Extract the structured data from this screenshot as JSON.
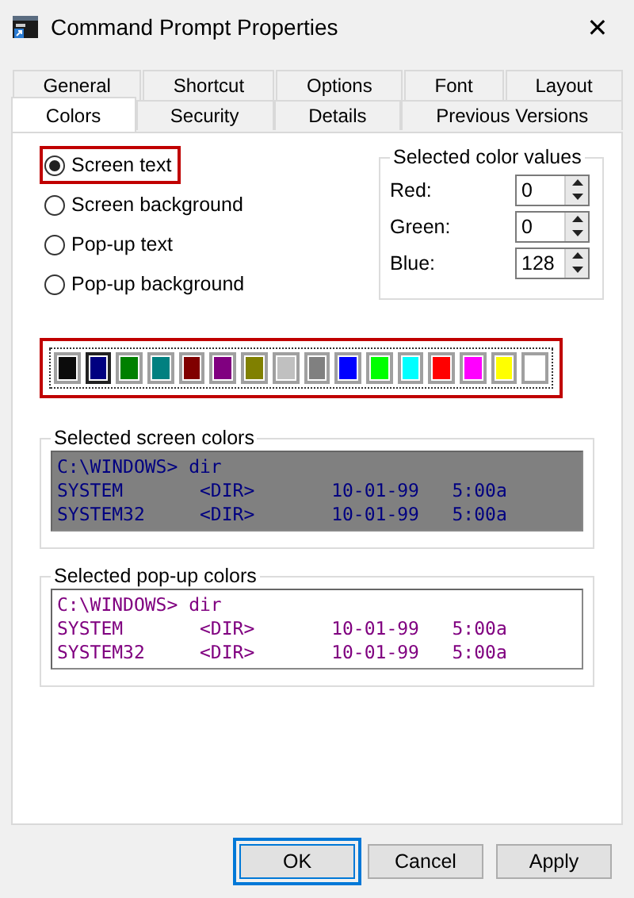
{
  "window": {
    "title": "Command Prompt Properties",
    "close_glyph": "✕"
  },
  "tab_rows": [
    [
      {
        "label": "General",
        "selected": false
      },
      {
        "label": "Shortcut",
        "selected": false
      },
      {
        "label": "Options",
        "selected": false
      },
      {
        "label": "Font",
        "selected": false
      },
      {
        "label": "Layout",
        "selected": false
      }
    ],
    [
      {
        "label": "Colors",
        "selected": true
      },
      {
        "label": "Security",
        "selected": false
      },
      {
        "label": "Details",
        "selected": false
      },
      {
        "label": "Previous Versions",
        "selected": false
      }
    ]
  ],
  "targets": [
    {
      "label": "Screen text",
      "selected": true,
      "highlighted": true
    },
    {
      "label": "Screen background",
      "selected": false,
      "highlighted": false
    },
    {
      "label": "Pop-up text",
      "selected": false,
      "highlighted": false
    },
    {
      "label": "Pop-up background",
      "selected": false,
      "highlighted": false
    }
  ],
  "color_values": {
    "title": "Selected color values",
    "fields": [
      {
        "label": "Red:",
        "value": "0"
      },
      {
        "label": "Green:",
        "value": "0"
      },
      {
        "label": "Blue:",
        "value": "128"
      }
    ]
  },
  "palette": {
    "highlighted": true,
    "swatches": [
      {
        "color": "#0c0c0c",
        "selected": false
      },
      {
        "color": "#000080",
        "selected": true
      },
      {
        "color": "#008000",
        "selected": false
      },
      {
        "color": "#008080",
        "selected": false
      },
      {
        "color": "#800000",
        "selected": false
      },
      {
        "color": "#800080",
        "selected": false
      },
      {
        "color": "#808000",
        "selected": false
      },
      {
        "color": "#c0c0c0",
        "selected": false
      },
      {
        "color": "#808080",
        "selected": false
      },
      {
        "color": "#0000ff",
        "selected": false
      },
      {
        "color": "#00ff00",
        "selected": false
      },
      {
        "color": "#00ffff",
        "selected": false
      },
      {
        "color": "#ff0000",
        "selected": false
      },
      {
        "color": "#ff00ff",
        "selected": false
      },
      {
        "color": "#ffff00",
        "selected": false
      },
      {
        "color": "#ffffff",
        "selected": false
      }
    ]
  },
  "previews": [
    {
      "title": "Selected screen colors",
      "kind": "screen",
      "lines": [
        "C:\\WINDOWS> dir",
        "SYSTEM       <DIR>       10-01-99   5:00a",
        "SYSTEM32     <DIR>       10-01-99   5:00a"
      ]
    },
    {
      "title": "Selected pop-up colors",
      "kind": "popup",
      "lines": [
        "C:\\WINDOWS> dir",
        "SYSTEM       <DIR>       10-01-99   5:00a",
        "SYSTEM32     <DIR>       10-01-99   5:00a"
      ]
    }
  ],
  "buttons": [
    {
      "label": "OK",
      "highlighted": true
    },
    {
      "label": "Cancel",
      "highlighted": false
    },
    {
      "label": "Apply",
      "highlighted": false
    }
  ]
}
